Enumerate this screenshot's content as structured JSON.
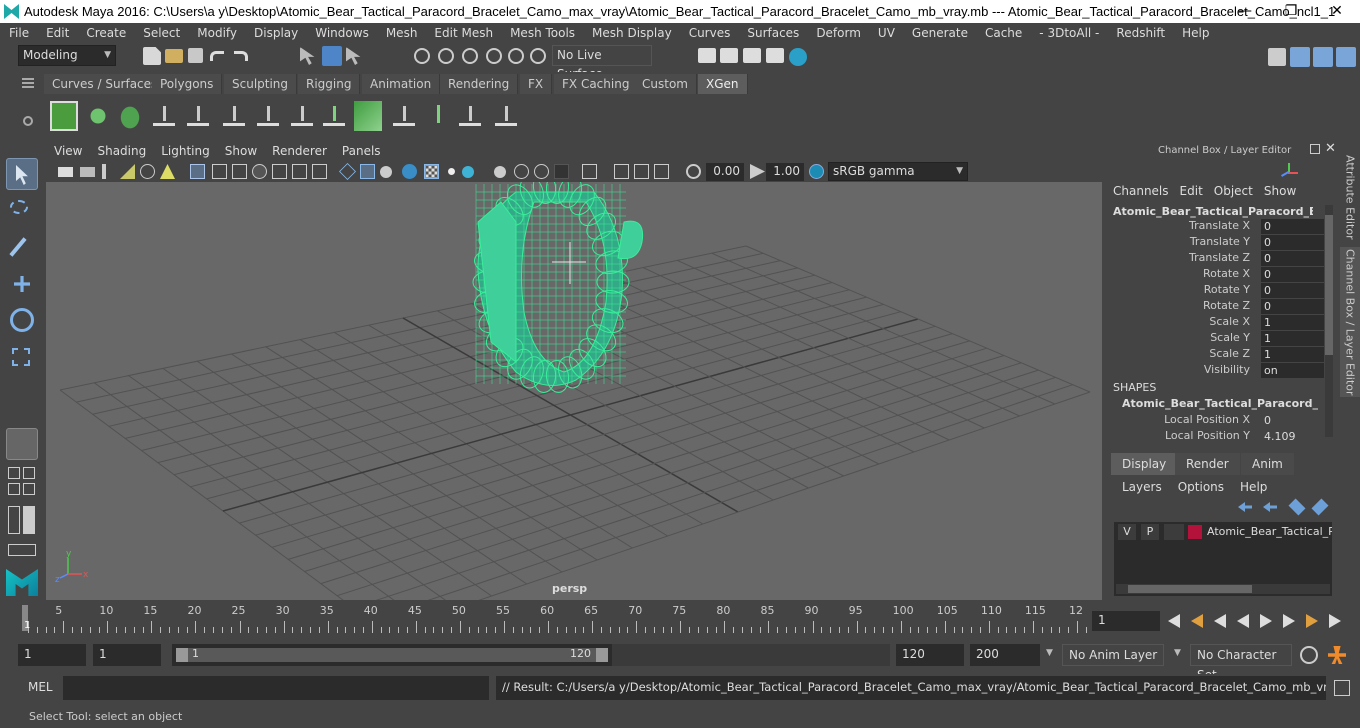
{
  "window": {
    "title": "Autodesk Maya 2016: C:\\Users\\a y\\Desktop\\Atomic_Bear_Tactical_Paracord_Bracelet_Camo_max_vray\\Atomic_Bear_Tactical_Paracord_Bracelet_Camo_mb_vray.mb   ---   Atomic_Bear_Tactical_Paracord_Bracelet_Camo_ncl1_1",
    "min": "—",
    "max": "❐",
    "close": "✕"
  },
  "menus": [
    "File",
    "Edit",
    "Create",
    "Select",
    "Modify",
    "Display",
    "Windows",
    "Mesh",
    "Edit Mesh",
    "Mesh Tools",
    "Mesh Display",
    "Curves",
    "Surfaces",
    "Deform",
    "UV",
    "Generate",
    "Cache",
    "- 3DtoAll -",
    "Redshift",
    "Help"
  ],
  "status": {
    "mode": "Modeling",
    "live_surface": "No Live Surface"
  },
  "shelf_tabs": [
    "Curves / Surfaces",
    "Polygons",
    "Sculpting",
    "Rigging",
    "Animation",
    "Rendering",
    "FX",
    "FX Caching",
    "Custom",
    "XGen"
  ],
  "active_shelf_tab": "XGen",
  "viewport": {
    "menus": [
      "View",
      "Shading",
      "Lighting",
      "Show",
      "Renderer",
      "Panels"
    ],
    "exposure": "0.00",
    "gamma": "1.00",
    "color_space": "sRGB gamma",
    "camera_label": "persp"
  },
  "channel_box": {
    "title": "Channel Box / Layer Editor",
    "menus": [
      "Channels",
      "Edit",
      "Object",
      "Show"
    ],
    "object_name": "Atomic_Bear_Tactical_Paracord_Bracel...",
    "attributes": [
      {
        "name": "Translate X",
        "value": "0"
      },
      {
        "name": "Translate Y",
        "value": "0"
      },
      {
        "name": "Translate Z",
        "value": "0"
      },
      {
        "name": "Rotate X",
        "value": "0"
      },
      {
        "name": "Rotate Y",
        "value": "0"
      },
      {
        "name": "Rotate Z",
        "value": "0"
      },
      {
        "name": "Scale X",
        "value": "1"
      },
      {
        "name": "Scale Y",
        "value": "1"
      },
      {
        "name": "Scale Z",
        "value": "1"
      },
      {
        "name": "Visibility",
        "value": "on"
      }
    ],
    "shapes_heading": "SHAPES",
    "shape_name": "Atomic_Bear_Tactical_Paracord_Brac...",
    "shape_attributes": [
      {
        "name": "Local Position X",
        "value": "0"
      },
      {
        "name": "Local Position Y",
        "value": "4.109"
      }
    ]
  },
  "layer_editor": {
    "tabs": [
      "Display",
      "Render",
      "Anim"
    ],
    "active_tab": "Display",
    "menus": [
      "Layers",
      "Options",
      "Help"
    ],
    "layer": {
      "v": "V",
      "p": "P",
      "name": "Atomic_Bear_Tactical_Par",
      "color": "#b3123a"
    }
  },
  "side_tabs": [
    "Attribute Editor",
    "Channel Box / Layer Editor"
  ],
  "timeline": {
    "ticks": [
      "5",
      "10",
      "15",
      "20",
      "25",
      "30",
      "35",
      "40",
      "45",
      "50",
      "55",
      "60",
      "65",
      "70",
      "75",
      "80",
      "85",
      "90",
      "95",
      "100",
      "105",
      "110",
      "115",
      "12"
    ],
    "start_mark": "1",
    "current_frame": "1"
  },
  "range": {
    "start": "1",
    "inner_start": "1",
    "slider_start": "1",
    "slider_end": "120",
    "end": "120",
    "max": "200",
    "anim_layer": "No Anim Layer",
    "character_set": "No Character Set"
  },
  "command": {
    "label": "MEL",
    "result": "// Result: C:/Users/a y/Desktop/Atomic_Bear_Tactical_Paracord_Bracelet_Camo_max_vray/Atomic_Bear_Tactical_Paracord_Bracelet_Camo_mb_vray.mb"
  },
  "help_line": "Select Tool: select an object",
  "colors": {
    "accent": "#5ce6b4",
    "wire": "#38ee9a",
    "bg": "#444444",
    "viewport": "#686868"
  }
}
